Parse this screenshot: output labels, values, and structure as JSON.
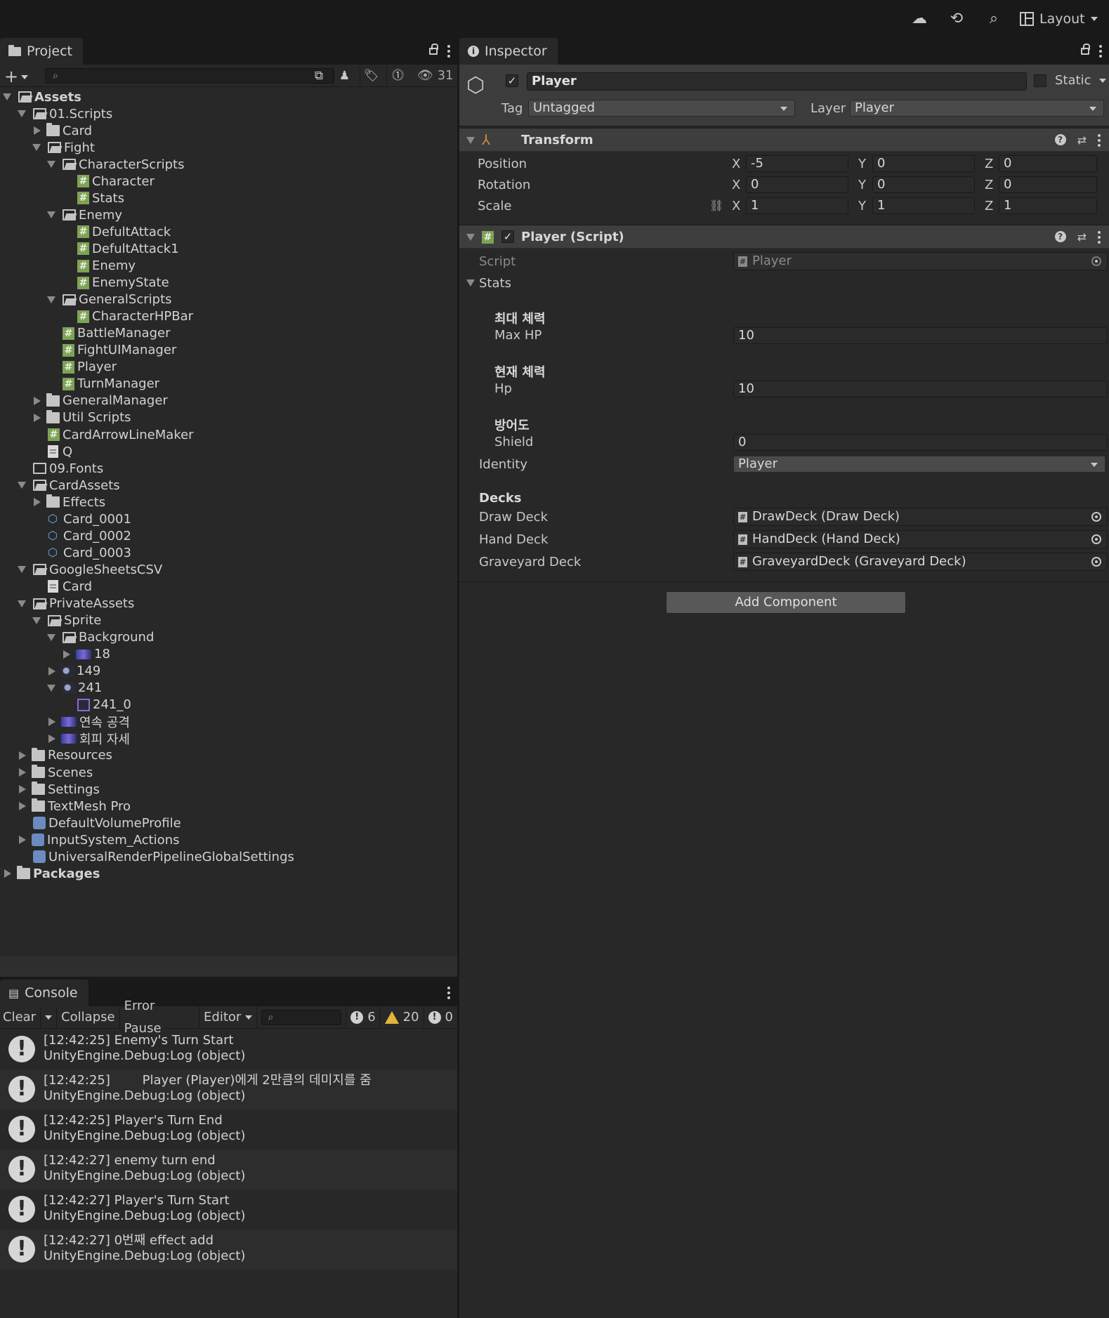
{
  "topbar": {
    "cloud_icon": "cloud-icon",
    "history_icon": "history-icon",
    "search_icon": "search-icon",
    "layout_label": "Layout"
  },
  "project": {
    "tab_label": "Project",
    "item_count": "31",
    "tree": [
      {
        "label": "Assets",
        "depth": 0,
        "arrow": "down",
        "icon": "open",
        "bold": true
      },
      {
        "label": "01.Scripts",
        "depth": 1,
        "arrow": "down",
        "icon": "open"
      },
      {
        "label": "Card",
        "depth": 2,
        "arrow": "right",
        "icon": "closed"
      },
      {
        "label": "Fight",
        "depth": 2,
        "arrow": "down",
        "icon": "open"
      },
      {
        "label": "CharacterScripts",
        "depth": 3,
        "arrow": "down",
        "icon": "open"
      },
      {
        "label": "Character",
        "depth": 4,
        "arrow": "none",
        "icon": "hash"
      },
      {
        "label": "Stats",
        "depth": 4,
        "arrow": "none",
        "icon": "hash"
      },
      {
        "label": "Enemy",
        "depth": 3,
        "arrow": "down",
        "icon": "open"
      },
      {
        "label": "DefultAttack",
        "depth": 4,
        "arrow": "none",
        "icon": "hash"
      },
      {
        "label": "DefultAttack1",
        "depth": 4,
        "arrow": "none",
        "icon": "hash"
      },
      {
        "label": "Enemy",
        "depth": 4,
        "arrow": "none",
        "icon": "hash"
      },
      {
        "label": "EnemyState",
        "depth": 4,
        "arrow": "none",
        "icon": "hash"
      },
      {
        "label": "GeneralScripts",
        "depth": 3,
        "arrow": "down",
        "icon": "open"
      },
      {
        "label": "CharacterHPBar",
        "depth": 4,
        "arrow": "none",
        "icon": "hash"
      },
      {
        "label": "BattleManager",
        "depth": 3,
        "arrow": "none",
        "icon": "hash"
      },
      {
        "label": "FightUIManager",
        "depth": 3,
        "arrow": "none",
        "icon": "hash"
      },
      {
        "label": "Player",
        "depth": 3,
        "arrow": "none",
        "icon": "hash"
      },
      {
        "label": "TurnManager",
        "depth": 3,
        "arrow": "none",
        "icon": "hash"
      },
      {
        "label": "GeneralManager",
        "depth": 2,
        "arrow": "right",
        "icon": "closed"
      },
      {
        "label": "Util Scripts",
        "depth": 2,
        "arrow": "right",
        "icon": "closed"
      },
      {
        "label": "CardArrowLineMaker",
        "depth": 2,
        "arrow": "none",
        "icon": "hash"
      },
      {
        "label": "Q",
        "depth": 2,
        "arrow": "none",
        "icon": "doc"
      },
      {
        "label": "09.Fonts",
        "depth": 1,
        "arrow": "none",
        "icon": "empty"
      },
      {
        "label": "CardAssets",
        "depth": 1,
        "arrow": "down",
        "icon": "open"
      },
      {
        "label": "Effects",
        "depth": 2,
        "arrow": "right",
        "icon": "closed"
      },
      {
        "label": "Card_0001",
        "depth": 2,
        "arrow": "none",
        "icon": "prefab"
      },
      {
        "label": "Card_0002",
        "depth": 2,
        "arrow": "none",
        "icon": "prefab"
      },
      {
        "label": "Card_0003",
        "depth": 2,
        "arrow": "none",
        "icon": "prefab"
      },
      {
        "label": "GoogleSheetsCSV",
        "depth": 1,
        "arrow": "down",
        "icon": "open"
      },
      {
        "label": "Card",
        "depth": 2,
        "arrow": "none",
        "icon": "doc"
      },
      {
        "label": "PrivateAssets",
        "depth": 1,
        "arrow": "down",
        "icon": "open"
      },
      {
        "label": "Sprite",
        "depth": 2,
        "arrow": "down",
        "icon": "open"
      },
      {
        "label": "Background",
        "depth": 3,
        "arrow": "down",
        "icon": "open"
      },
      {
        "label": "18",
        "depth": 4,
        "arrow": "right",
        "icon": "sprite"
      },
      {
        "label": "149",
        "depth": 3,
        "arrow": "right",
        "icon": "sprite2"
      },
      {
        "label": "241",
        "depth": 3,
        "arrow": "down",
        "icon": "sprite2"
      },
      {
        "label": "241_0",
        "depth": 4,
        "arrow": "none",
        "icon": "spritesel"
      },
      {
        "label": "연속 공격",
        "depth": 3,
        "arrow": "right",
        "icon": "sprite"
      },
      {
        "label": "회피 자세",
        "depth": 3,
        "arrow": "right",
        "icon": "sprite"
      },
      {
        "label": "Resources",
        "depth": 1,
        "arrow": "right",
        "icon": "closed"
      },
      {
        "label": "Scenes",
        "depth": 1,
        "arrow": "right",
        "icon": "closed"
      },
      {
        "label": "Settings",
        "depth": 1,
        "arrow": "right",
        "icon": "closed"
      },
      {
        "label": "TextMesh Pro",
        "depth": 1,
        "arrow": "right",
        "icon": "closed"
      },
      {
        "label": "DefaultVolumeProfile",
        "depth": 1,
        "arrow": "none",
        "icon": "asset"
      },
      {
        "label": "InputSystem_Actions",
        "depth": 1,
        "arrow": "right",
        "icon": "asset"
      },
      {
        "label": "UniversalRenderPipelineGlobalSettings",
        "depth": 1,
        "arrow": "none",
        "icon": "asset"
      },
      {
        "label": "Packages",
        "depth": 0,
        "arrow": "right",
        "icon": "closed",
        "bold": true
      }
    ]
  },
  "console": {
    "tab_label": "Console",
    "clear_label": "Clear",
    "collapse_label": "Collapse",
    "error_pause_label": "Error Pause",
    "editor_label": "Editor",
    "log_count": "6",
    "warning_count": "20",
    "error_count": "0",
    "logs": [
      {
        "line1": "[12:42:25] Enemy's Turn Start",
        "line2": "UnityEngine.Debug:Log (object)"
      },
      {
        "line1": "[12:42:25]        Player (Player)에게 2만큼의 데미지를 줌",
        "line2": "UnityEngine.Debug:Log (object)"
      },
      {
        "line1": "[12:42:25] Player's Turn End",
        "line2": "UnityEngine.Debug:Log (object)"
      },
      {
        "line1": "[12:42:27] enemy turn end",
        "line2": "UnityEngine.Debug:Log (object)"
      },
      {
        "line1": "[12:42:27] Player's Turn Start",
        "line2": "UnityEngine.Debug:Log (object)"
      },
      {
        "line1": "[12:42:27] 0번째 effect add",
        "line2": "UnityEngine.Debug:Log (object)"
      }
    ]
  },
  "inspector": {
    "tab_label": "Inspector",
    "object_name": "Player",
    "static_label": "Static",
    "tag_label": "Tag",
    "tag_value": "Untagged",
    "layer_label": "Layer",
    "layer_value": "Player",
    "transform": {
      "title": "Transform",
      "position_label": "Position",
      "rotation_label": "Rotation",
      "scale_label": "Scale",
      "position": {
        "x": "-5",
        "y": "0",
        "z": "0"
      },
      "rotation": {
        "x": "0",
        "y": "0",
        "z": "0"
      },
      "scale": {
        "x": "1",
        "y": "1",
        "z": "1"
      }
    },
    "script_component": {
      "title": "Player (Script)",
      "script_label": "Script",
      "script_value": "Player",
      "stats_label": "Stats",
      "max_hp_header": "최대 체력",
      "max_hp_label": "Max HP",
      "max_hp_value": "10",
      "hp_header": "현재 체력",
      "hp_label": "Hp",
      "hp_value": "10",
      "shield_header": "방어도",
      "shield_label": "Shield",
      "shield_value": "0",
      "identity_label": "Identity",
      "identity_value": "Player",
      "decks_header": "Decks",
      "draw_deck_label": "Draw Deck",
      "draw_deck_value": "DrawDeck (Draw Deck)",
      "hand_deck_label": "Hand Deck",
      "hand_deck_value": "HandDeck (Hand Deck)",
      "graveyard_deck_label": "Graveyard Deck",
      "graveyard_deck_value": "GraveyardDeck (Graveyard Deck)"
    },
    "add_component_label": "Add Component"
  },
  "colors": {
    "background": "#191919",
    "panel": "#282828",
    "script_icon": "#7da356",
    "warning": "#e3b43a"
  }
}
